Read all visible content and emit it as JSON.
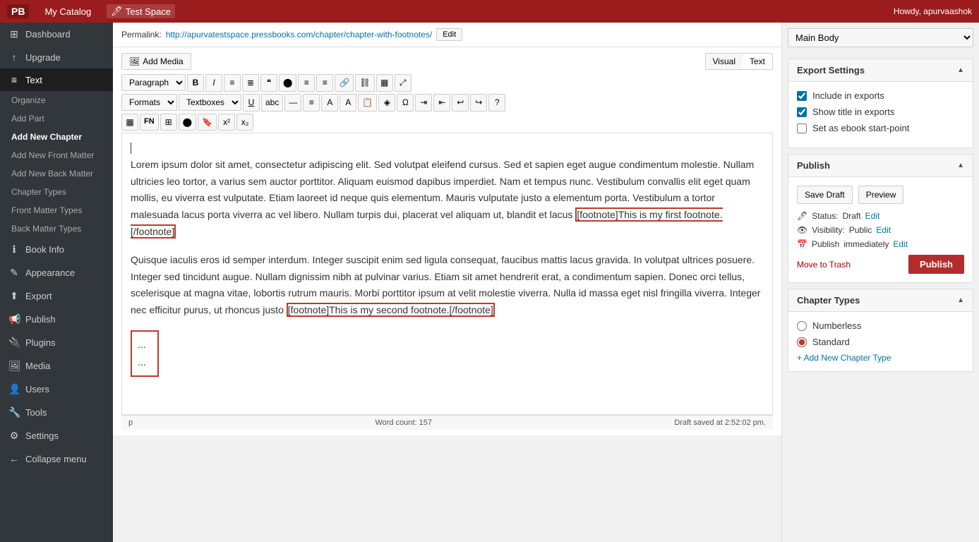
{
  "topbar": {
    "logo": "PB",
    "catalog_label": "My Catalog",
    "tab_label": "Test Space",
    "howdy_label": "Howdy, apurvaashok"
  },
  "sidebar": {
    "items": [
      {
        "id": "dashboard",
        "icon": "⊞",
        "label": "Dashboard"
      },
      {
        "id": "upgrade",
        "icon": "↑",
        "label": "Upgrade"
      },
      {
        "id": "text",
        "icon": "📝",
        "label": "Text",
        "active": true
      },
      {
        "id": "organize",
        "label": "Organize"
      },
      {
        "id": "add-part",
        "label": "Add Part"
      },
      {
        "id": "add-new-chapter",
        "label": "Add New Chapter",
        "active": true
      },
      {
        "id": "add-new-front-matter",
        "label": "Add New Front Matter"
      },
      {
        "id": "add-new-back-matter",
        "label": "Add New Back Matter"
      },
      {
        "id": "chapter-types",
        "label": "Chapter Types"
      },
      {
        "id": "front-matter-types",
        "label": "Front Matter Types"
      },
      {
        "id": "back-matter-types",
        "label": "Back Matter Types"
      },
      {
        "id": "book-info",
        "icon": "ℹ",
        "label": "Book Info"
      },
      {
        "id": "appearance",
        "icon": "🎨",
        "label": "Appearance"
      },
      {
        "id": "export",
        "icon": "⬆",
        "label": "Export"
      },
      {
        "id": "publish",
        "icon": "📢",
        "label": "Publish"
      },
      {
        "id": "plugins",
        "icon": "🔌",
        "label": "Plugins"
      },
      {
        "id": "media",
        "icon": "🖼",
        "label": "Media"
      },
      {
        "id": "users",
        "icon": "👤",
        "label": "Users"
      },
      {
        "id": "tools",
        "icon": "🔧",
        "label": "Tools"
      },
      {
        "id": "settings",
        "icon": "⚙",
        "label": "Settings"
      },
      {
        "id": "collapse",
        "icon": "←",
        "label": "Collapse menu"
      }
    ]
  },
  "permalink": {
    "label": "Permalink:",
    "url": "http://apurvatestspace.pressbooks.com/chapter/chapter-with-footnotes/",
    "edit_label": "Edit"
  },
  "editor": {
    "add_media_label": "Add Media",
    "visual_label": "Visual",
    "text_label": "Text",
    "paragraph_dropdown": "Paragraph",
    "formats_label": "Formats",
    "textboxes_label": "Textboxes",
    "content_p1": "Lorem ipsum dolor sit amet, consectetur adipiscing elit. Sed volutpat eleifend cursus. Sed et sapien eget augue condimentum molestie. Nullam ultricies leo tortor, a varius sem auctor porttitor. Aliquam euismod dapibus imperdiet. Nam et tempus nunc. Vestibulum convallis elit eget quam mollis, eu viverra est vulputate. Etiam laoreet id neque quis elementum. Mauris vulputate justo a elementum porta. Vestibulum a tortor malesuada lacus porta viverra ac vel libero. Nullam turpis dui, placerat vel aliquam ut, blandit et lacus ",
    "footnote1": "[footnote]This is my first footnote.[/footnote]",
    "content_p2": "Quisque iaculis eros id semper interdum. Integer suscipit enim sed ligula consequat, faucibus mattis lacus gravida. In volutpat ultrices posuere. Integer sed tincidunt augue. Nullam dignissim nibh at pulvinar varius. Etiam sit amet hendrerit erat, a condimentum sapien. Donec orci tellus, scelerisque at magna vitae, lobortis rutrum mauris. Morbi porttitor ipsum at velit molestie viverra. Nulla id massa eget nisl fringilla viverra. Integer nec efficitur purus, ut rhoncus justo ",
    "footnote2": "[footnote]This is my second footnote.[/footnote]",
    "dots1": "...",
    "dots2": "...",
    "footer_tag": "p",
    "word_count_label": "Word count:",
    "word_count": "157",
    "draft_saved": "Draft saved at 2:52:02 pm."
  },
  "right_panel": {
    "dropdown_option": "Main Body",
    "export_settings": {
      "title": "Export Settings",
      "include_in_exports_label": "Include in exports",
      "include_in_exports_checked": true,
      "show_title_label": "Show title in exports",
      "show_title_checked": true,
      "ebook_start_label": "Set as ebook start-point",
      "ebook_start_checked": false
    },
    "publish_section": {
      "title": "Publish",
      "save_draft_label": "Save Draft",
      "preview_label": "Preview",
      "status_label": "Status:",
      "status_value": "Draft",
      "status_edit": "Edit",
      "visibility_label": "Visibility:",
      "visibility_value": "Public",
      "visibility_edit": "Edit",
      "publish_label": "Publish",
      "publish_time": "immediately",
      "publish_time_edit": "Edit",
      "move_to_trash_label": "Move to Trash",
      "publish_btn_label": "Publish"
    },
    "chapter_types": {
      "title": "Chapter Types",
      "options": [
        {
          "label": "Numberless",
          "checked": false
        },
        {
          "label": "Standard",
          "checked": true
        }
      ],
      "add_new_label": "+ Add New Chapter Type"
    }
  }
}
